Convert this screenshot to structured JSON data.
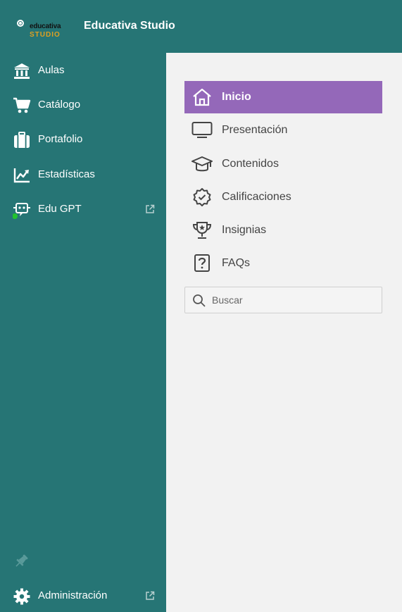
{
  "header": {
    "logo_line1": "educativa",
    "logo_line2": "STUDIO",
    "title": "Educativa Studio"
  },
  "sidebar": {
    "items": [
      {
        "label": "Aulas",
        "icon": "bank-icon"
      },
      {
        "label": "Catálogo",
        "icon": "cart-icon"
      },
      {
        "label": "Portafolio",
        "icon": "briefcase-icon"
      },
      {
        "label": "Estadísticas",
        "icon": "chart-icon"
      },
      {
        "label": "Edu GPT",
        "icon": "bot-icon",
        "external": true,
        "status": "online"
      }
    ],
    "admin": {
      "label": "Administración",
      "icon": "gear-icon",
      "external": true
    }
  },
  "panel": {
    "menu": [
      {
        "label": "Inicio",
        "icon": "home-icon",
        "active": true
      },
      {
        "label": "Presentación",
        "icon": "monitor-icon"
      },
      {
        "label": "Contenidos",
        "icon": "graduation-cap-icon"
      },
      {
        "label": "Calificaciones",
        "icon": "badge-check-icon"
      },
      {
        "label": "Insignias",
        "icon": "trophy-icon"
      },
      {
        "label": "FAQs",
        "icon": "question-icon"
      }
    ],
    "search": {
      "placeholder": "Buscar",
      "value": ""
    }
  },
  "colors": {
    "teal": "#267575",
    "active": "#9468b9",
    "panel_bg": "#f2f2f2",
    "logo_accent": "#e0a021",
    "status_online": "#22c32e"
  }
}
